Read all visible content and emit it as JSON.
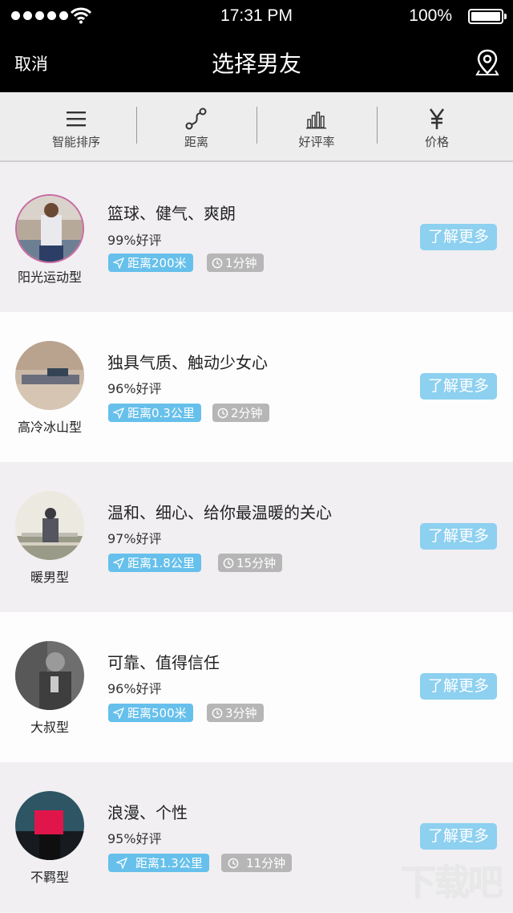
{
  "status_bar": {
    "time": "17:31 PM",
    "battery": "100%"
  },
  "nav": {
    "cancel_label": "取消",
    "title": "选择男友"
  },
  "filters": [
    {
      "label": "智能排序",
      "icon": "list-icon"
    },
    {
      "label": "距离",
      "icon": "route-icon"
    },
    {
      "label": "好评率",
      "icon": "bar-chart-icon"
    },
    {
      "label": "价格",
      "icon": "yen-icon"
    }
  ],
  "items": [
    {
      "type": "阳光运动型",
      "headline": "篮球、健气、爽朗",
      "rating": "99%好评",
      "distance": "距离200米",
      "time": "1分钟",
      "button": "了解更多"
    },
    {
      "type": "高冷冰山型",
      "headline": "独具气质、触动少女心",
      "rating": "96%好评",
      "distance": "距离0.3公里",
      "time": "2分钟",
      "button": "了解更多"
    },
    {
      "type": "暖男型",
      "headline": "温和、细心、给你最温暖的关心",
      "rating": "97%好评",
      "distance": "距离1.8公里",
      "time": "15分钟",
      "button": "了解更多"
    },
    {
      "type": "大叔型",
      "headline": "可靠、值得信任",
      "rating": "96%好评",
      "distance": "距离500米",
      "time": "3分钟",
      "button": "了解更多"
    },
    {
      "type": "不羁型",
      "headline": "浪漫、个性",
      "rating": "95%好评",
      "distance": "距离1.3公里",
      "time": "11分钟",
      "button": "了解更多"
    }
  ],
  "watermark": "下载吧"
}
